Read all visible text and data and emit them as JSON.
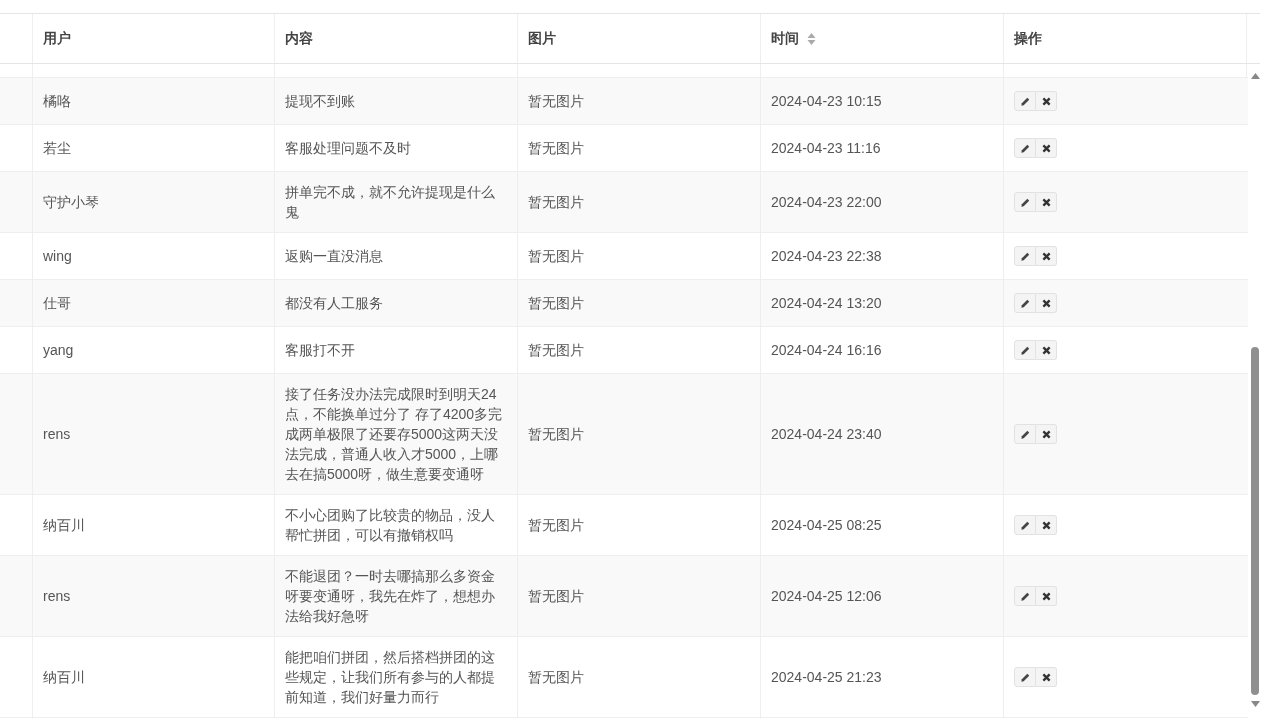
{
  "table": {
    "columns": [
      {
        "label": "用户",
        "sortable": false
      },
      {
        "label": "内容",
        "sortable": false
      },
      {
        "label": "图片",
        "sortable": false
      },
      {
        "label": "时间",
        "sortable": true
      },
      {
        "label": "操作",
        "sortable": false
      }
    ],
    "rows": [
      {
        "user": "橘咯",
        "content": "提现不到账",
        "image": "暂无图片",
        "time": "2024-04-23 10:15"
      },
      {
        "user": "若尘",
        "content": "客服处理问题不及时",
        "image": "暂无图片",
        "time": "2024-04-23 11:16"
      },
      {
        "user": "守护小琴",
        "content": "拼单完不成，就不允许提现是什么鬼",
        "image": "暂无图片",
        "time": "2024-04-23 22:00"
      },
      {
        "user": "wing",
        "content": "返购一直没消息",
        "image": "暂无图片",
        "time": "2024-04-23 22:38"
      },
      {
        "user": "仕哥",
        "content": "都没有人工服务",
        "image": "暂无图片",
        "time": "2024-04-24 13:20"
      },
      {
        "user": "yang",
        "content": "客服打不开",
        "image": "暂无图片",
        "time": "2024-04-24 16:16"
      },
      {
        "user": "rens",
        "content": "接了任务没办法完成限时到明天24点，不能换单过分了 存了4200多完成两单极限了还要存5000这两天没法完成，普通人收入才5000，上哪去在搞5000呀，做生意要变通呀",
        "image": "暂无图片",
        "time": "2024-04-24 23:40"
      },
      {
        "user": "纳百川",
        "content": "不小心团购了比较贵的物品，没人帮忙拼团，可以有撤销权吗",
        "image": "暂无图片",
        "time": "2024-04-25 08:25"
      },
      {
        "user": "rens",
        "content": "不能退团？一时去哪搞那么多资金呀要变通呀，我先在炸了，想想办法给我好急呀",
        "image": "暂无图片",
        "time": "2024-04-25 12:06"
      },
      {
        "user": "纳百川",
        "content": "能把咱们拼团，然后搭档拼团的这些规定，让我们所有参与的人都提前知道，我们好量力而行",
        "image": "暂无图片",
        "time": "2024-04-25 21:23"
      }
    ]
  }
}
